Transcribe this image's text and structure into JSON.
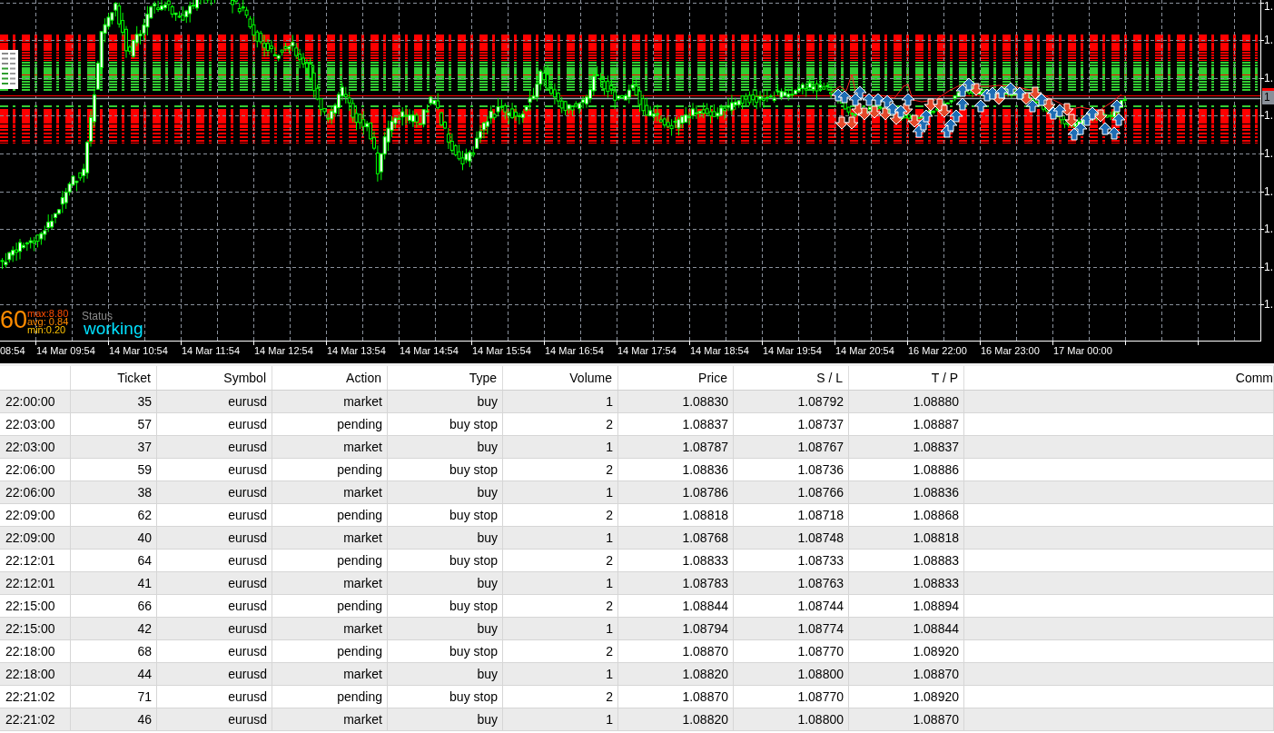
{
  "chart": {
    "price_axis_labels": [
      "1.",
      "1.",
      "1.",
      "1.",
      "1.",
      "1.",
      "1.",
      "1.",
      "1."
    ],
    "current_price_tag": "1",
    "time_axis_labels": [
      "08:54",
      "14 Mar 09:54",
      "14 Mar 10:54",
      "14 Mar 11:54",
      "14 Mar 12:54",
      "14 Mar 13:54",
      "14 Mar 14:54",
      "14 Mar 15:54",
      "14 Mar 16:54",
      "14 Mar 17:54",
      "14 Mar 18:54",
      "14 Mar 19:54",
      "14 Mar 20:54",
      "16 Mar 22:00",
      "16 Mar 23:00",
      "17 Mar 00:00"
    ],
    "overlay": {
      "value": "60",
      "stats": [
        "max:8.80",
        "avg: 0.84",
        "min:0.20"
      ],
      "status_label": "Status",
      "status": "working"
    }
  },
  "table": {
    "columns": [
      "",
      "Ticket",
      "Symbol",
      "Action",
      "Type",
      "Volume",
      "Price",
      "S / L",
      "T / P",
      "Comm"
    ],
    "rows": [
      [
        "22:00:00",
        "35",
        "eurusd",
        "market",
        "buy",
        "1",
        "1.08830",
        "1.08792",
        "1.08880"
      ],
      [
        "22:03:00",
        "57",
        "eurusd",
        "pending",
        "buy stop",
        "2",
        "1.08837",
        "1.08737",
        "1.08887"
      ],
      [
        "22:03:00",
        "37",
        "eurusd",
        "market",
        "buy",
        "1",
        "1.08787",
        "1.08767",
        "1.08837"
      ],
      [
        "22:06:00",
        "59",
        "eurusd",
        "pending",
        "buy stop",
        "2",
        "1.08836",
        "1.08736",
        "1.08886"
      ],
      [
        "22:06:00",
        "38",
        "eurusd",
        "market",
        "buy",
        "1",
        "1.08786",
        "1.08766",
        "1.08836"
      ],
      [
        "22:09:00",
        "62",
        "eurusd",
        "pending",
        "buy stop",
        "2",
        "1.08818",
        "1.08718",
        "1.08868"
      ],
      [
        "22:09:00",
        "40",
        "eurusd",
        "market",
        "buy",
        "1",
        "1.08768",
        "1.08748",
        "1.08818"
      ],
      [
        "22:12:01",
        "64",
        "eurusd",
        "pending",
        "buy stop",
        "2",
        "1.08833",
        "1.08733",
        "1.08883"
      ],
      [
        "22:12:01",
        "41",
        "eurusd",
        "market",
        "buy",
        "1",
        "1.08783",
        "1.08763",
        "1.08833"
      ],
      [
        "22:15:00",
        "66",
        "eurusd",
        "pending",
        "buy stop",
        "2",
        "1.08844",
        "1.08744",
        "1.08894"
      ],
      [
        "22:15:00",
        "42",
        "eurusd",
        "market",
        "buy",
        "1",
        "1.08794",
        "1.08774",
        "1.08844"
      ],
      [
        "22:18:00",
        "68",
        "eurusd",
        "pending",
        "buy stop",
        "2",
        "1.08870",
        "1.08770",
        "1.08920"
      ],
      [
        "22:18:00",
        "44",
        "eurusd",
        "market",
        "buy",
        "1",
        "1.08820",
        "1.08800",
        "1.08870"
      ],
      [
        "22:21:02",
        "71",
        "eurusd",
        "pending",
        "buy stop",
        "2",
        "1.08870",
        "1.08770",
        "1.08920"
      ],
      [
        "22:21:02",
        "46",
        "eurusd",
        "market",
        "buy",
        "1",
        "1.08820",
        "1.08800",
        "1.08870"
      ]
    ]
  }
}
